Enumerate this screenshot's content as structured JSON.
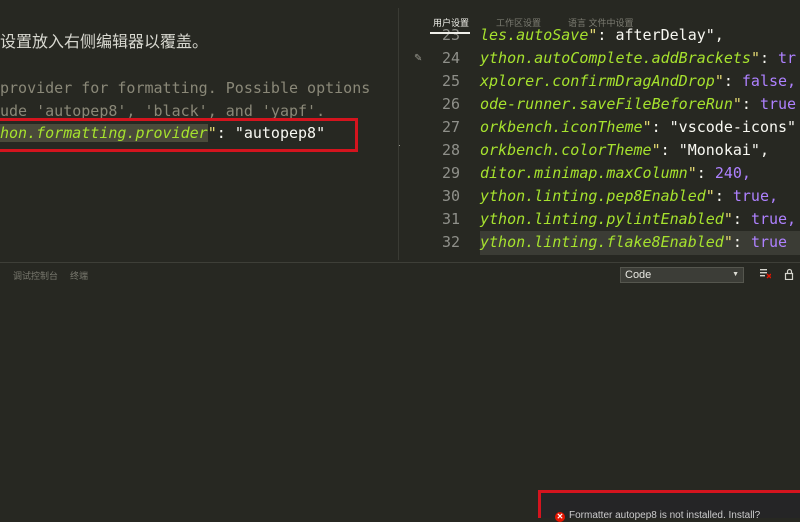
{
  "left_editor": {
    "hint": "设置放入右侧编辑器以覆盖。",
    "comment_1": "provider for formatting. Possible options",
    "comment_2": "ude 'autopep8', 'black', and 'yapf'.",
    "provider_key": "hon.formatting.provider",
    "provider_quote": "\"",
    "provider_colon": ": ",
    "provider_value": "\"autopep8\""
  },
  "settings_tabs": {
    "user": "用户设置",
    "workspace": "工作区设置",
    "language": "语言 文件中设置"
  },
  "right_editor": {
    "lines": [
      {
        "no": "23",
        "key": "les.autoSave",
        "val": "afterDelay\",",
        "val_kind": "string"
      },
      {
        "no": "24",
        "key": "ython.autoComplete.addBrackets",
        "val": "tr",
        "val_kind": "bool"
      },
      {
        "no": "25",
        "key": "xplorer.confirmDragAndDrop",
        "val": "false,",
        "val_kind": "bool"
      },
      {
        "no": "26",
        "key": "ode-runner.saveFileBeforeRun",
        "val": "true",
        "val_kind": "bool"
      },
      {
        "no": "27",
        "key": "orkbench.iconTheme",
        "val": "\"vscode-icons\"",
        "val_kind": "string"
      },
      {
        "no": "28",
        "key": "orkbench.colorTheme",
        "val": "\"Monokai\",",
        "val_kind": "string"
      },
      {
        "no": "29",
        "key": "ditor.minimap.maxColumn",
        "val": "240,",
        "val_kind": "number"
      },
      {
        "no": "30",
        "key": "ython.linting.pep8Enabled",
        "val": "true,",
        "val_kind": "bool"
      },
      {
        "no": "31",
        "key": "ython.linting.pylintEnabled",
        "val": "true,",
        "val_kind": "bool"
      },
      {
        "no": "32",
        "key": "ython.linting.flake8Enabled",
        "val": "true",
        "val_kind": "bool"
      }
    ]
  },
  "panel": {
    "tab_debug_console": "调试控制台",
    "tab_output": "终端",
    "select_value": "Code"
  },
  "notification": {
    "icon": "error-icon",
    "text": "Formatter autopep8 is not installed. Install?"
  },
  "colors": {
    "background": "#272822",
    "highlight_red": "#d4141e",
    "keyword_green": "#a6e22e",
    "string_yellow": "#e6db74",
    "constant_purple": "#ae81ff"
  }
}
